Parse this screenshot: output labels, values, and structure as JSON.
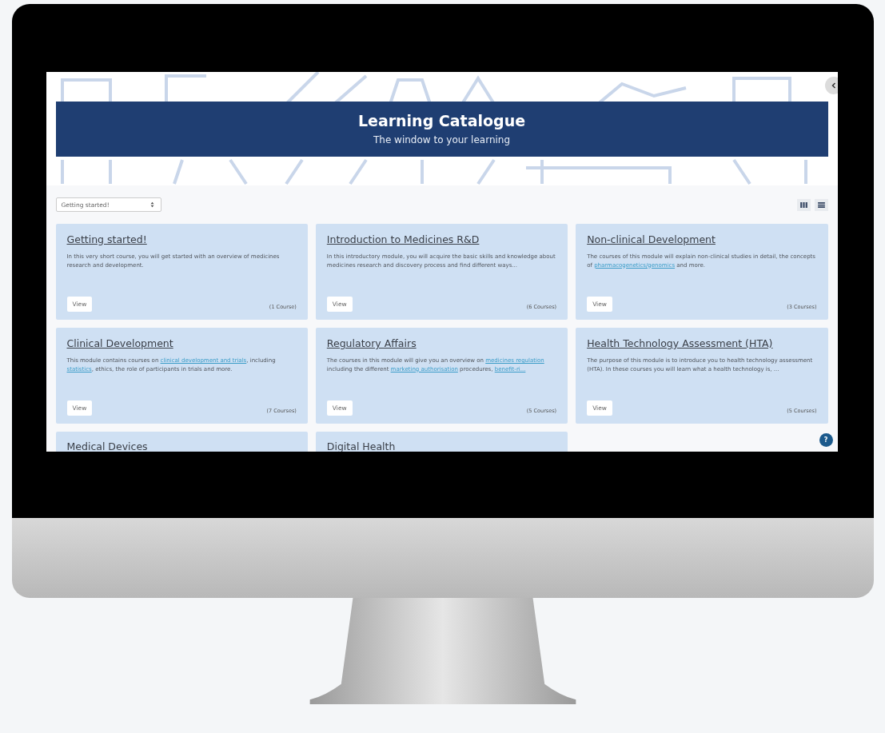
{
  "banner": {
    "title": "Learning Catalogue",
    "subtitle": "The window to your learning"
  },
  "filter": {
    "value": "Getting started!"
  },
  "cards": [
    {
      "title": "Getting started!",
      "description": [
        {
          "text": "In this very short course, you will get started with an overview of medicines research and development.",
          "link": false
        }
      ],
      "button": "View",
      "count": "(1 Course)"
    },
    {
      "title": "Introduction to Medicines R&D",
      "description": [
        {
          "text": "In this introductory module, you will acquire the basic skills and knowledge about medicines research and discovery process and find different ways...",
          "link": false
        }
      ],
      "button": "View",
      "count": "(6 Courses)"
    },
    {
      "title": "Non-clinical Development",
      "description": [
        {
          "text": "The courses of this module will explain non-clinical studies in detail, the concepts of ",
          "link": false
        },
        {
          "text": "pharmacogenetics/genomics",
          "link": true
        },
        {
          "text": " and more.",
          "link": false
        }
      ],
      "button": "View",
      "count": "(3 Courses)"
    },
    {
      "title": "Clinical Development",
      "description": [
        {
          "text": "This module contains courses on ",
          "link": false
        },
        {
          "text": "clinical development and trials",
          "link": true
        },
        {
          "text": ", including ",
          "link": false
        },
        {
          "text": "statistics",
          "link": true
        },
        {
          "text": ", ethics, the role of participants in trials and more.",
          "link": false
        }
      ],
      "button": "View",
      "count": "(7 Courses)"
    },
    {
      "title": "Regulatory Affairs",
      "description": [
        {
          "text": "The courses in this module will give you an overview on ",
          "link": false
        },
        {
          "text": "medicines regulation",
          "link": true
        },
        {
          "text": " including the different ",
          "link": false
        },
        {
          "text": "marketing authorisation",
          "link": true
        },
        {
          "text": " procedures, ",
          "link": false
        },
        {
          "text": "benefit-ri...",
          "link": true
        }
      ],
      "button": "View",
      "count": "(5 Courses)"
    },
    {
      "title": "Health Technology Assessment (HTA)",
      "description": [
        {
          "text": "The purpose of this module is to introduce you to health technology assessment (HTA). In these courses you will learn what a health technology is, ...",
          "link": false
        }
      ],
      "button": "View",
      "count": "(5 Courses)"
    },
    {
      "title": "Medical Devices"
    },
    {
      "title": "Digital Health"
    }
  ],
  "help_button": {
    "label": "?"
  }
}
